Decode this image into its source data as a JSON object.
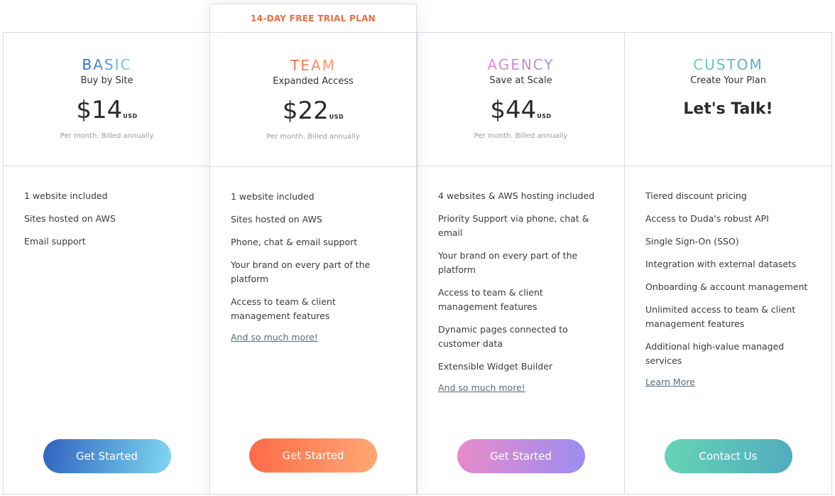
{
  "trial_banner": "14-DAY FREE TRIAL PLAN",
  "plans": [
    {
      "name": "BASIC",
      "subtitle": "Buy by Site",
      "price": "$14",
      "currency": "USD",
      "billing": "Per month. Billed annually",
      "features": [
        "1 website included",
        "Sites hosted on AWS",
        "Email support"
      ],
      "more": "",
      "button": "Get Started",
      "colors": [
        "#2f63c0",
        "#7fd8f0"
      ]
    },
    {
      "name": "TEAM",
      "subtitle": "Expanded Access",
      "price": "$22",
      "currency": "USD",
      "billing": "Per month. Billed annually",
      "features": [
        "1 website included",
        "Sites hosted on AWS",
        "Phone, chat & email support",
        "Your brand on every part of the platform",
        "Access to team & client management features"
      ],
      "more": "And so much more!",
      "button": "Get Started",
      "colors": [
        "#fd6a45",
        "#ffa875"
      ]
    },
    {
      "name": "AGENCY",
      "subtitle": "Save at Scale",
      "price": "$44",
      "currency": "USD",
      "billing": "Per month. Billed annually",
      "features": [
        "4 websites & AWS hosting included",
        "Priority Support via phone, chat & email",
        "Your brand on every part of the platform",
        "Access to team & client management features",
        "Dynamic pages connected to customer data",
        "Extensible Widget Builder"
      ],
      "more": "And so much more!",
      "button": "Get Started",
      "colors": [
        "#e98bc9",
        "#9a8df2"
      ]
    },
    {
      "name": "CUSTOM",
      "subtitle": "Create Your Plan",
      "price_text": "Let's Talk!",
      "features": [
        "Tiered discount pricing",
        "Access to Duda's robust API",
        "Single Sign-On (SSO)",
        "Integration with external datasets",
        "Onboarding & account management",
        "Unlimited access to team & client management features",
        "Additional high-value managed services"
      ],
      "more": "Learn More",
      "button": "Contact Us",
      "colors": [
        "#66d4b4",
        "#52abc0"
      ]
    }
  ]
}
